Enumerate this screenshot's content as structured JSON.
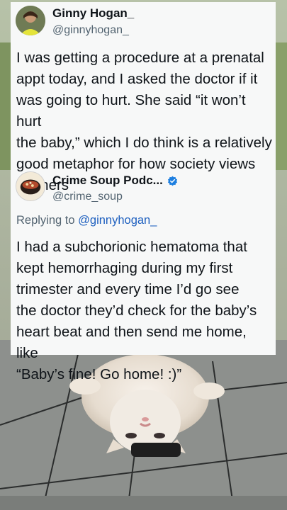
{
  "original_tweet": {
    "display_name": "Ginny Hogan_",
    "handle": "@ginnyhogan_",
    "avatar_icon": "person-avatar",
    "text": "I was getting a procedure at a prenatal\nappt today, and I asked the doctor if it\nwas going to hurt. She said “it won’t hurt\nthe baby,” which I do think is a relatively\ngood metaphor for how society views\nmothers"
  },
  "reply_tweet": {
    "display_name": "Crime Soup Podc...",
    "handle": "@crime_soup",
    "avatar_icon": "soup-bowl-avatar",
    "verified_icon": "verified-badge-icon",
    "replying_label": "Replying to",
    "replying_to": "@ginnyhogan_",
    "text": "I had a subchorionic hematoma that\nkept hemorrhaging during my first\ntrimester and every time I’d go see\nthe doctor they’d check for the baby’s\nheart beat and then send me home, like\n“Baby’s fine! Go home! :)”"
  },
  "colors": {
    "card_bg": "#f7f8f8",
    "text": "#0f1419",
    "secondary": "#536471",
    "mention": "#1d5fbf",
    "verified": "#1d7fe0"
  }
}
